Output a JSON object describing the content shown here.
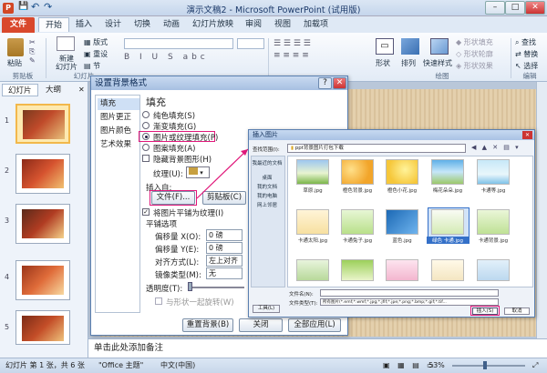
{
  "window": {
    "title": "演示文稿2 - Microsoft PowerPoint (试用版)",
    "min": "–",
    "max": "□",
    "close": "✕"
  },
  "quick_access": {
    "save": "💾",
    "undo": "↶",
    "redo": "↷"
  },
  "tabs": {
    "file": "文件",
    "items": [
      "开始",
      "插入",
      "设计",
      "切换",
      "动画",
      "幻灯片放映",
      "审阅",
      "视图",
      "加载项"
    ]
  },
  "ribbon": {
    "paste": "粘贴",
    "new_slide": "新建\n幻灯片",
    "layout": "版式",
    "reset": "重设",
    "section": "节",
    "clipboard_group": "剪贴板",
    "slides_group": "幻灯片",
    "shape": "形状",
    "arrange": "排列",
    "quick_styles": "快速样式",
    "shape_fill": "形状填充",
    "shape_outline": "形状轮廓",
    "shape_effects": "形状效果",
    "find": "查找",
    "replace": "替换",
    "select": "选择",
    "drawing_group": "绘图",
    "editing_group": "编辑"
  },
  "left_pane": {
    "tab_slides": "幻灯片",
    "tab_outline": "大纲",
    "slide_numbers": [
      "1",
      "2",
      "3",
      "4",
      "5"
    ]
  },
  "notes": "单击此处添加备注",
  "status": {
    "slide_info": "幻灯片 第 1 张，共 6 张",
    "theme": "\"Office 主题\"",
    "language": "中文(中国)",
    "zoom": "53%"
  },
  "format_bg": {
    "title": "设置背景格式",
    "help": "?",
    "close": "✕",
    "nav": [
      "填充",
      "图片更正",
      "图片颜色",
      "艺术效果"
    ],
    "section_title": "填充",
    "options": [
      "纯色填充(S)",
      "渐变填充(G)",
      "图片或纹理填充(P)",
      "图案填充(A)"
    ],
    "hide_bg": "隐藏背景图形(H)",
    "texture": "纹理(U):",
    "insert_from": "插入自:",
    "file_btn": "文件(F)...",
    "clipboard_btn": "剪贴板(C)",
    "tile": "将图片平铺为纹理(I)",
    "tile_options": "平铺选项",
    "offset_x_label": "偏移量 X(O):",
    "offset_x": "0 磅",
    "offset_y_label": "偏移量 Y(E):",
    "offset_y": "0 磅",
    "align_label": "对齐方式(L):",
    "align": "左上对齐",
    "mirror_label": "镜像类型(M):",
    "mirror": "无",
    "transparency_label": "透明度(T):",
    "transparency": "0%",
    "rotate": "与形状一起旋转(W)",
    "reset_btn": "重置背景(B)",
    "close_btn": "关闭",
    "apply_all_btn": "全部应用(L)"
  },
  "insert_pic": {
    "title": "插入图片",
    "look_in_label": "查找范围(I):",
    "look_in": "ppt背景图片打包下载",
    "places": [
      "我最近的文档",
      "桌面",
      "我的文档",
      "我的电脑",
      "网上邻居"
    ],
    "files": [
      "草原.jpg",
      "橙色背景.jpg",
      "橙色小花.jpg",
      "梅花朵朵.jpg",
      "卡通等.jpg",
      "卡通太阳.jpg",
      "卡通兔子.jpg",
      "蓝色.jpg",
      "绿色 卡通.jpg",
      "卡通背景.jpg",
      "",
      "",
      "",
      "",
      ""
    ],
    "filename_label": "文件名(N):",
    "filetype_label": "文件类型(T):",
    "filetype": "所有图片(*.emf;*.wmf;*.jpg;*.jfif;*.jpe;*.png;*.bmp;*.gif;*.tif...",
    "tools": "工具(L)",
    "insert_btn": "插入(S)",
    "cancel_btn": "取消"
  }
}
